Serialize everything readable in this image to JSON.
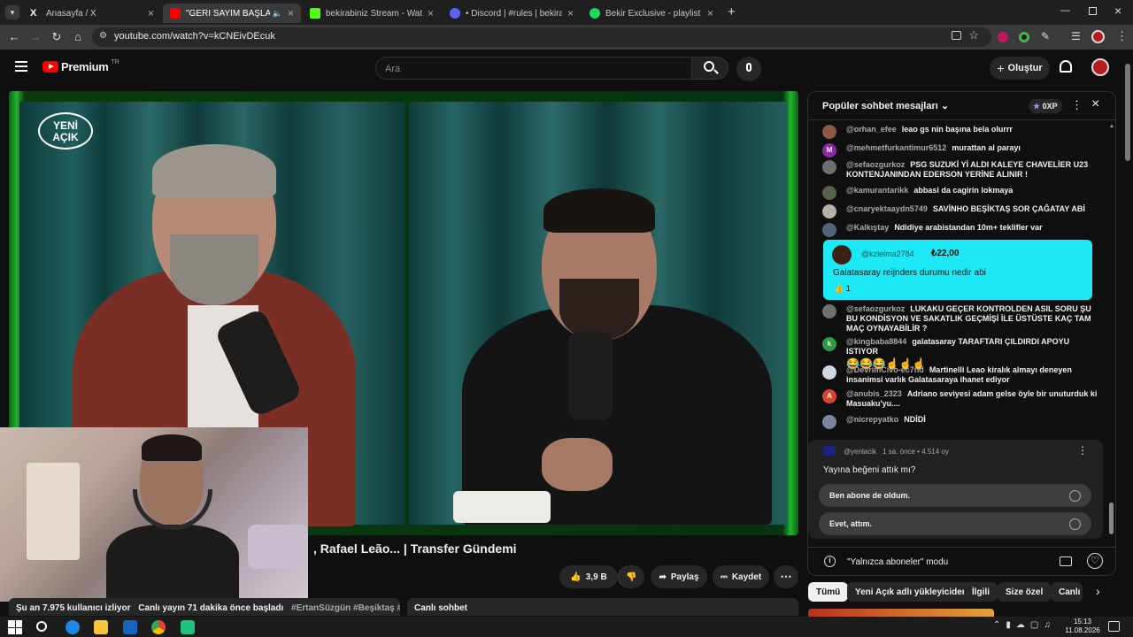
{
  "tabs": [
    {
      "title": "Anasayfa / X",
      "color": "#000000"
    },
    {
      "title": "\"GERİ SAYIM BAŞLADI\" Du",
      "color": "#ff0000"
    },
    {
      "title": "bekirabiniz Stream - Watch Live",
      "color": "#53fc18"
    },
    {
      "title": "• Discord | #rules | bekirabiniz",
      "color": "#5865f2"
    },
    {
      "title": "Bekir Exclusive - playlist by Bek",
      "color": "#1ed760"
    }
  ],
  "new_tab": "+",
  "url": "youtube.com/watch?v=kCNEivDEcuk",
  "yt": {
    "brand": "Premium",
    "brand_sup": "TR",
    "search_placeholder": "Ara",
    "create_label": "Oluştur"
  },
  "video": {
    "logo_line1": "YENİ",
    "logo_line2": "AÇIK",
    "title": ", Rafael Leão... | Transfer Gündemi",
    "likes": "3,9 B",
    "share": "Paylaş",
    "save": "Kaydet"
  },
  "description": {
    "viewers": "Şu an 7.975 kullanıcı izliyor",
    "started": "Canlı yayın 71 dakika önce başladı",
    "tags": "#ErtanSüzgün #Beşiktaş #ÇağataySö"
  },
  "livechat_bar": "Canlı sohbet",
  "chat": {
    "header": "Popüler sohbet mesajları",
    "xp": "0XP",
    "messages": [
      {
        "author": "@orhan_efee",
        "text": "leao gs nin başına bela olurrr",
        "color": "#8a5a44"
      },
      {
        "author": "@mehmetfurkantimur6512",
        "text": "murattan al parayı",
        "color": "#8e2aa8"
      },
      {
        "author": "@sefaozgurkoz",
        "text": "PSG SUZUKİ Yİ ALDI KALEYE CHAVELİER U23 KONTENJANINDAN EDERSON YERİNE ALINIR !",
        "color": "#6f6f6f"
      },
      {
        "author": "@kamurantarikk",
        "text": "abbasi da cagirin lokmaya",
        "color": "#55624c"
      },
      {
        "author": "@cnaryektaaydn5749",
        "text": "SAVİNHO BEŞİKTAŞ SOR ÇAĞATAY ABİ",
        "color": "#b5b0ad"
      },
      {
        "author": "@Kalkıştay",
        "text": "Ndidiye arabistandan 10m+ teklifler var",
        "color": "#50637a"
      },
      {
        "author": "@sefaozgurkoz",
        "text": "LUKAKU GEÇER KONTROLDEN ASIL SORU ŞU BU KONDİSYON VE SAKATLIK GEÇMİŞİ İLE ÜSTÜSTE KAÇ TAM MAÇ OYNAYABİLİR ?",
        "color": "#6f6f6f"
      },
      {
        "author": "@kingbaba8844",
        "text": "galatasaray TARAFTARI ÇILDIRDI APOYU ISTIYOR",
        "color": "#2e9b45"
      },
      {
        "author": "@DevrimCivo-ec7nd",
        "text": "Martinelli Leao kiralık almayı deneyen insanimsi varlık Galatasaraya ihanet ediyor",
        "color": "#d0d6e4"
      },
      {
        "author": "@anubis_2323",
        "text": "Adriano seviyesi adam gelse öyle bir unuturduk ki Masuaku'yu....",
        "color": "#d8452e"
      },
      {
        "author": "@nicrepyatko",
        "text": "NDİDİ",
        "color": "#7a86a0"
      }
    ],
    "emoji_row": "😂😂😂☝☝☝",
    "kingbaba_initial": "k",
    "anubis_initial": "A",
    "mehmet_initial": "M",
    "superchat": {
      "author": "@kzlelma2784",
      "amount": "₺22,00",
      "text": "Galatasaray reijnders durumu nedir abi",
      "likes": "1"
    },
    "poll": {
      "author": "@yenlacik",
      "meta": "1 sa. önce • 4.514 oy",
      "question": "Yayına beğeni attık mı?",
      "options": [
        "Ben abone de oldum.",
        "Evet, attım."
      ]
    },
    "footer": "\"Yalnızca aboneler\" modu"
  },
  "chips": [
    "Tümü",
    "Yeni Açık adlı yükleyiciden",
    "İlgili",
    "Size özel",
    "Canlı"
  ],
  "taskbar": {
    "time": "15:13",
    "date": "11.08.2026"
  }
}
